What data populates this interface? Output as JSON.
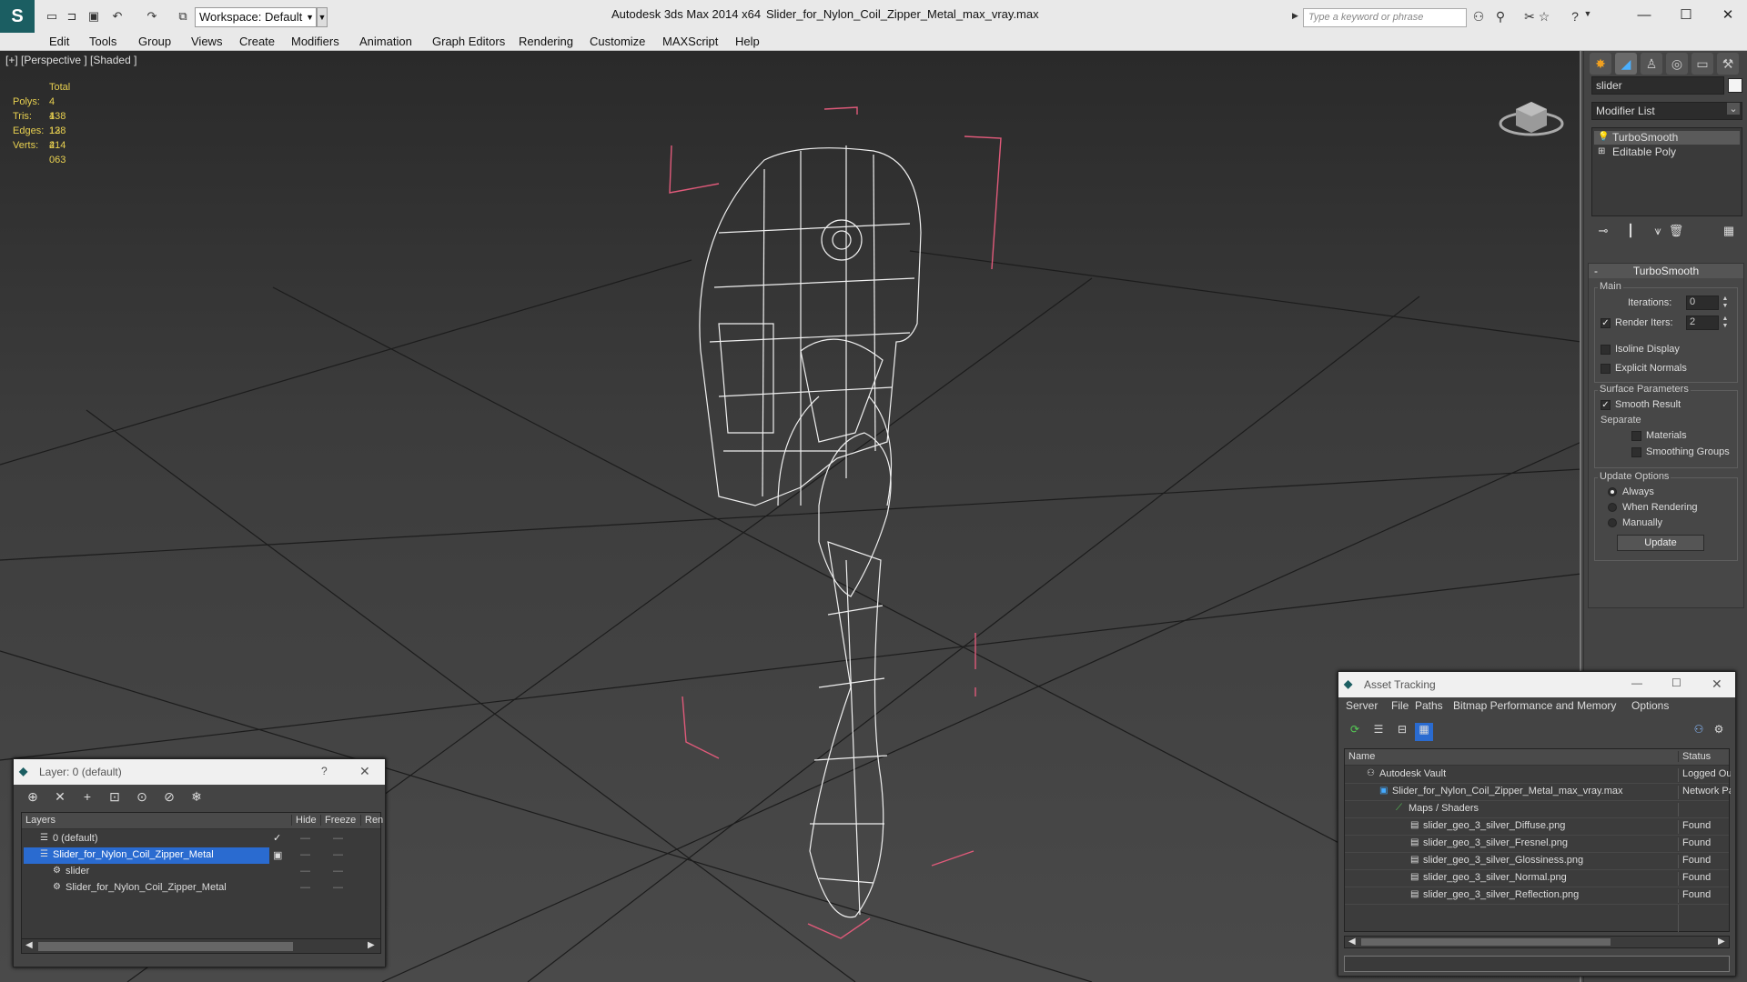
{
  "titlebar": {
    "workspace": "Workspace: Default",
    "app_title": "Autodesk 3ds Max  2014 x64",
    "file_title": "Slider_for_Nylon_Coil_Zipper_Metal_max_vray.max",
    "search_placeholder": "Type a keyword or phrase"
  },
  "menu": [
    "Edit",
    "Tools",
    "Group",
    "Views",
    "Create",
    "Modifiers",
    "Animation",
    "Graph Editors",
    "Rendering",
    "Customize",
    "MAXScript",
    "Help"
  ],
  "viewport": {
    "label": "[+] [Perspective ] [Shaded ]",
    "stats": {
      "header": "Total",
      "rows": [
        {
          "label": "Polys:",
          "value": "4 138"
        },
        {
          "label": "Tris:",
          "value": "4 138"
        },
        {
          "label": "Edges:",
          "value": "12 414"
        },
        {
          "label": "Verts:",
          "value": "2 063"
        }
      ]
    }
  },
  "command_panel": {
    "object_name": "slider",
    "modifier_list": "Modifier List",
    "stack": [
      "TurboSmooth",
      "Editable Poly"
    ],
    "rollout_title": "TurboSmooth",
    "main_group": "Main",
    "iterations_label": "Iterations:",
    "iterations_value": "0",
    "render_iters_label": "Render Iters:",
    "render_iters_value": "2",
    "isoline_display": "Isoline Display",
    "explicit_normals": "Explicit Normals",
    "surface_params": "Surface Parameters",
    "smooth_result": "Smooth Result",
    "separate": "Separate",
    "materials": "Materials",
    "smoothing_groups": "Smoothing Groups",
    "update_options": "Update Options",
    "always": "Always",
    "when_rendering": "When Rendering",
    "manually": "Manually",
    "update_button": "Update"
  },
  "layer_dialog": {
    "title": "Layer: 0 (default)",
    "help": "?",
    "columns": [
      "Layers",
      "Hide",
      "Freeze",
      "Ren"
    ],
    "rows": [
      "0 (default)",
      "Slider_for_Nylon_Coil_Zipper_Metal",
      "slider",
      "Slider_for_Nylon_Coil_Zipper_Metal"
    ]
  },
  "asset_dialog": {
    "title": "Asset Tracking",
    "menu": [
      "Server",
      "File",
      "Paths",
      "Bitmap Performance and Memory",
      "Options"
    ],
    "columns": [
      "Name",
      "Status"
    ],
    "rows": [
      {
        "name": "Autodesk Vault",
        "status": "Logged Out"
      },
      {
        "name": "Slider_for_Nylon_Coil_Zipper_Metal_max_vray.max",
        "status": "Network Path"
      },
      {
        "name": "Maps / Shaders",
        "status": ""
      },
      {
        "name": "slider_geo_3_silver_Diffuse.png",
        "status": "Found"
      },
      {
        "name": "slider_geo_3_silver_Fresnel.png",
        "status": "Found"
      },
      {
        "name": "slider_geo_3_silver_Glossiness.png",
        "status": "Found"
      },
      {
        "name": "slider_geo_3_silver_Normal.png",
        "status": "Found"
      },
      {
        "name": "slider_geo_3_silver_Reflection.png",
        "status": "Found"
      }
    ]
  }
}
